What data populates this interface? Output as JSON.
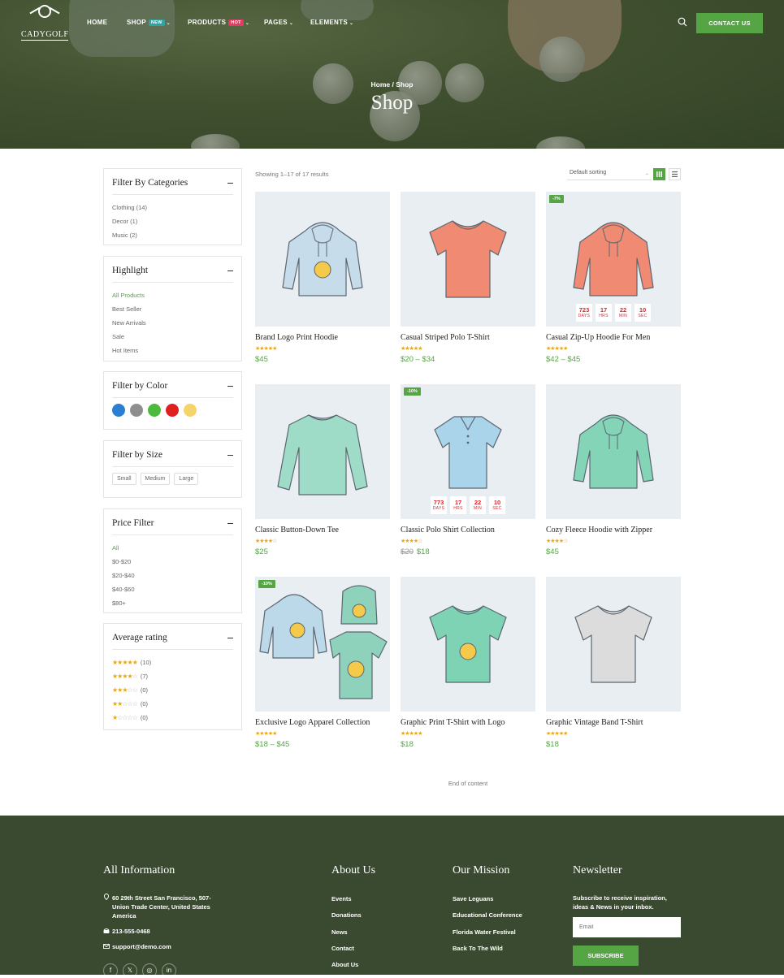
{
  "brand": {
    "name": "CADYGOLF"
  },
  "nav": {
    "items": [
      {
        "label": "HOME"
      },
      {
        "label": "SHOP",
        "badge": "NEW"
      },
      {
        "label": "PRODUCTS",
        "badge": "HOT"
      },
      {
        "label": "PAGES"
      },
      {
        "label": "ELEMENTS"
      }
    ],
    "contact_label": "CONTACT US"
  },
  "hero": {
    "breadcrumb": "Home / Shop",
    "title": "Shop"
  },
  "sidebar": {
    "categories": {
      "title": "Filter By Categories",
      "items": [
        "Clothing (14)",
        "Decor (1)",
        "Music (2)"
      ]
    },
    "highlight": {
      "title": "Highlight",
      "items": [
        "All Products",
        "Best Seller",
        "New Arrivals",
        "Sale",
        "Hot Items"
      ]
    },
    "color": {
      "title": "Filter by Color",
      "colors": [
        "#2b7fd0",
        "#8f8f8f",
        "#4cba3c",
        "#de2020",
        "#f5d46a"
      ]
    },
    "size": {
      "title": "Filter by Size",
      "items": [
        "Small",
        "Medium",
        "Large"
      ]
    },
    "price": {
      "title": "Price Filter",
      "items": [
        "All",
        "$0-$20",
        "$20-$40",
        "$40-$60",
        "$80+"
      ]
    },
    "rating": {
      "title": "Average rating",
      "items": [
        {
          "stars": 5,
          "count": "(10)"
        },
        {
          "stars": 4,
          "count": "(7)"
        },
        {
          "stars": 3,
          "count": "(0)"
        },
        {
          "stars": 2,
          "count": "(0)"
        },
        {
          "stars": 1,
          "count": "(0)"
        }
      ]
    }
  },
  "toolbar": {
    "results": "Showing 1–17 of 17 results",
    "sort": "Default sorting"
  },
  "products": [
    {
      "name": "Brand Logo Print Hoodie",
      "price": "$45",
      "stars": 5,
      "color": "#c7dcea"
    },
    {
      "name": "Casual Striped Polo T-Shirt",
      "price": "$20 – $34",
      "stars": 4.5,
      "color": "#f08a72"
    },
    {
      "name": "Casual Zip-Up Hoodie For Men",
      "price": "$42 – $45",
      "stars": 4.5,
      "sale": "-7%",
      "countdown": [
        "723",
        "17",
        "22",
        "10"
      ],
      "color": "#f08a72"
    },
    {
      "name": "Classic Button-Down Tee",
      "price": "$25",
      "stars": 4,
      "color": "#9fdcc7"
    },
    {
      "name": "Classic Polo Shirt Collection",
      "old_price": "$20",
      "price": "$18",
      "stars": 4,
      "sale": "-10%",
      "countdown": [
        "773",
        "17",
        "22",
        "10"
      ],
      "color": "#a9d4ea"
    },
    {
      "name": "Cozy Fleece Hoodie with Zipper",
      "price": "$45",
      "stars": 4,
      "color": "#84d4b8"
    },
    {
      "name": "Exclusive Logo Apparel Collection",
      "price": "$18 – $45",
      "stars": 5,
      "sale": "-10%",
      "color": "#a9d4ea"
    },
    {
      "name": "Graphic Print T-Shirt with Logo",
      "price": "$18",
      "stars": 4.5,
      "color": "#7fd3b5"
    },
    {
      "name": "Graphic Vintage Band T-Shirt",
      "price": "$18",
      "stars": 5,
      "color": "#dcdcdc"
    }
  ],
  "countdown_units": [
    "DAYS",
    "HRS",
    "MIN",
    "SEC"
  ],
  "end_text": "End of content",
  "footer": {
    "info": {
      "title": "All Information",
      "address": "60 29th Street San Francisco, 507-Union Trade Center, United States America",
      "phone": "213-555-0468",
      "email": "support@demo.com"
    },
    "about": {
      "title": "About Us",
      "links": [
        "Events",
        "Donations",
        "News",
        "Contact",
        "About Us"
      ]
    },
    "mission": {
      "title": "Our Mission",
      "links": [
        "Save Leguans",
        "Educational Conference",
        "Florida Water Festival",
        "Back To The Wild"
      ]
    },
    "newsletter": {
      "title": "Newsletter",
      "text": "Subscribe to receive inspiration, ideas & News in your inbox.",
      "placeholder": "Email",
      "button": "SUBSCRIBE"
    },
    "social": [
      "facebook-icon",
      "x-icon",
      "instagram-icon",
      "linkedin-icon"
    ]
  }
}
